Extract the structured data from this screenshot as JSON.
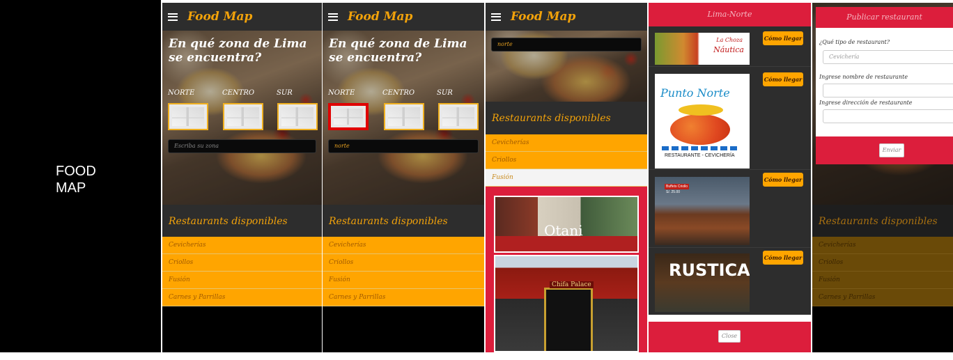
{
  "app": {
    "logo": "Food Map",
    "intro_title": "FOOD MAP"
  },
  "colors": {
    "accent": "#ffa500",
    "logo": "#f2a20a",
    "header": "#2d2d2d",
    "modal": "#dc1e3c",
    "selected_border": "#e00000"
  },
  "home": {
    "question": "En qué zona de Lima se encuentra?",
    "zones": [
      "NORTE",
      "CENTRO",
      "SUR"
    ],
    "search_placeholder": "Escriba su zona",
    "search_value": "norte",
    "available_title": "Restaurants disponibles",
    "categories": [
      "Cevicherías",
      "Criollos",
      "Fusión",
      "Carnes y Parrillas"
    ]
  },
  "screen4": {
    "search_value": "norte",
    "available_title": "Restaurants disponibles",
    "categories": [
      "Cevicherías",
      "Criollos",
      "Fusión"
    ],
    "restaurant_signs": [
      "Otani",
      "Chifa Palace"
    ]
  },
  "lima_norte": {
    "title": "Lima-Norte",
    "how_to_label": "Cómo llegar",
    "restaurants": [
      {
        "name_line1": "La Choza",
        "name_line2": "Náutica"
      },
      {
        "name": "Punto Norte",
        "subtitle": "RESTAURANTE - CEVICHERÍA"
      },
      {
        "sign": "Buffets Criollo",
        "price": "S/. 25.00"
      },
      {
        "name": "RUSTICA"
      }
    ],
    "close_label": "Close"
  },
  "publish": {
    "title": "Publicar restaurant",
    "type_label": "¿Qué tipo de restaurant?",
    "type_placeholder": "Cevichería",
    "name_label": "Ingrese nombre de restaurante",
    "address_label": "Ingrese dirección de restaurante",
    "submit_label": "Enviar",
    "available_title": "Restaurants disponibles",
    "categories": [
      "Cevicherías",
      "Criollos",
      "Fusión",
      "Carnes y Parrillas"
    ]
  }
}
